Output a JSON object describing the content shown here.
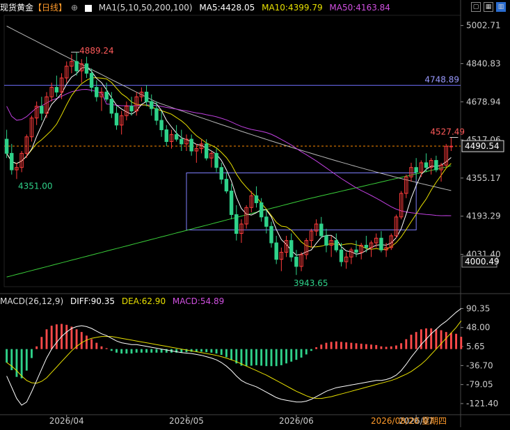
{
  "header": {
    "instrument": "现货黄金",
    "period": "【日线】",
    "ma_label": "MA1(5,10,50,200,100)",
    "ma5": "MA5:4428.05",
    "ma10": "MA10:4399.79",
    "ma50": "MA50:4163.84"
  },
  "macd_header": {
    "label": "MACD(26,12,9)",
    "diff": "DIFF:90.35",
    "dea": "DEA:62.90",
    "macd": "MACD:54.89"
  },
  "colors": {
    "up": "#ff3b3b",
    "down": "#2fd28a",
    "ma5": "#ffffff",
    "ma10": "#e8e000",
    "ma50": "#c040e0",
    "ma100": "#b8b8b8",
    "ma200": "#3ad03a",
    "hline": "#7070ff",
    "box": "#8080ff",
    "last": "#ff8a00"
  },
  "chart_data": {
    "type": "candlestick",
    "x_tick_labels": [
      "2026/04",
      "2026/05",
      "2026/06",
      "2026/07",
      "2026/08/20 星期四"
    ],
    "price_axis": {
      "range": [
        3900,
        5040
      ],
      "ticks": [
        5002.71,
        4840.83,
        4678.94,
        4517.06,
        4355.17,
        4193.29,
        4031.4
      ]
    },
    "last_price": 4490.54,
    "box_bottom_price": 4000.49,
    "horizontal_line": 4748.89,
    "labels": {
      "high": "4889.24",
      "low_april": "4351.00",
      "low_july": "3943.65",
      "recent_high": "4527.49",
      "hline": "4748.89",
      "last": "4490.54",
      "box_bottom": "4000.49"
    },
    "candles": [
      [
        4520,
        4560,
        4440,
        4460
      ],
      [
        4460,
        4500,
        4370,
        4390
      ],
      [
        4390,
        4420,
        4351,
        4400
      ],
      [
        4400,
        4470,
        4380,
        4460
      ],
      [
        4460,
        4540,
        4440,
        4530
      ],
      [
        4530,
        4620,
        4510,
        4610
      ],
      [
        4610,
        4680,
        4580,
        4660
      ],
      [
        4660,
        4700,
        4600,
        4630
      ],
      [
        4630,
        4720,
        4610,
        4700
      ],
      [
        4700,
        4760,
        4680,
        4740
      ],
      [
        4740,
        4790,
        4700,
        4720
      ],
      [
        4720,
        4800,
        4690,
        4780
      ],
      [
        4780,
        4850,
        4760,
        4830
      ],
      [
        4830,
        4880,
        4800,
        4850
      ],
      [
        4850,
        4889.24,
        4790,
        4810
      ],
      [
        4810,
        4860,
        4760,
        4840
      ],
      [
        4840,
        4870,
        4780,
        4800
      ],
      [
        4800,
        4820,
        4720,
        4740
      ],
      [
        4740,
        4770,
        4680,
        4700
      ],
      [
        4700,
        4740,
        4640,
        4720
      ],
      [
        4720,
        4760,
        4680,
        4690
      ],
      [
        4690,
        4720,
        4610,
        4630
      ],
      [
        4630,
        4660,
        4560,
        4580
      ],
      [
        4580,
        4640,
        4540,
        4620
      ],
      [
        4620,
        4680,
        4600,
        4660
      ],
      [
        4660,
        4700,
        4620,
        4640
      ],
      [
        4640,
        4720,
        4620,
        4700
      ],
      [
        4700,
        4740,
        4680,
        4720
      ],
      [
        4720,
        4750,
        4660,
        4680
      ],
      [
        4680,
        4710,
        4620,
        4650
      ],
      [
        4650,
        4680,
        4580,
        4600
      ],
      [
        4600,
        4640,
        4530,
        4560
      ],
      [
        4560,
        4580,
        4490,
        4510
      ],
      [
        4510,
        4560,
        4480,
        4540
      ],
      [
        4540,
        4580,
        4510,
        4520
      ],
      [
        4520,
        4560,
        4470,
        4500
      ],
      [
        4500,
        4540,
        4470,
        4520
      ],
      [
        4520,
        4540,
        4450,
        4470
      ],
      [
        4470,
        4500,
        4420,
        4480
      ],
      [
        4480,
        4520,
        4460,
        4500
      ],
      [
        4500,
        4520,
        4430,
        4440
      ],
      [
        4440,
        4470,
        4400,
        4460
      ],
      [
        4460,
        4480,
        4380,
        4400
      ],
      [
        4400,
        4420,
        4330,
        4350
      ],
      [
        4350,
        4380,
        4290,
        4300
      ],
      [
        4300,
        4330,
        4180,
        4200
      ],
      [
        4200,
        4240,
        4090,
        4120
      ],
      [
        4120,
        4180,
        4080,
        4160
      ],
      [
        4160,
        4240,
        4140,
        4230
      ],
      [
        4230,
        4300,
        4210,
        4280
      ],
      [
        4280,
        4320,
        4230,
        4250
      ],
      [
        4250,
        4270,
        4170,
        4190
      ],
      [
        4190,
        4220,
        4120,
        4150
      ],
      [
        4150,
        4170,
        4060,
        4080
      ],
      [
        4080,
        4110,
        3990,
        4010
      ],
      [
        4010,
        4060,
        3960,
        4040
      ],
      [
        4040,
        4110,
        4020,
        4090
      ],
      [
        4090,
        4120,
        4000,
        4020
      ],
      [
        4020,
        4050,
        3943.65,
        3980
      ],
      [
        3980,
        4040,
        3960,
        4030
      ],
      [
        4030,
        4100,
        4010,
        4090
      ],
      [
        4090,
        4140,
        4060,
        4130
      ],
      [
        4130,
        4180,
        4110,
        4160
      ],
      [
        4160,
        4190,
        4100,
        4110
      ],
      [
        4110,
        4140,
        4040,
        4070
      ],
      [
        4070,
        4110,
        4020,
        4090
      ],
      [
        4090,
        4120,
        4040,
        4050
      ],
      [
        4050,
        4080,
        3980,
        4000
      ],
      [
        4000,
        4040,
        3970,
        4020
      ],
      [
        4020,
        4060,
        3990,
        4050
      ],
      [
        4050,
        4090,
        4020,
        4040
      ],
      [
        4040,
        4080,
        4010,
        4070
      ],
      [
        4070,
        4110,
        4040,
        4060
      ],
      [
        4060,
        4090,
        4020,
        4080
      ],
      [
        4080,
        4120,
        4060,
        4100
      ],
      [
        4100,
        4130,
        4040,
        4050
      ],
      [
        4050,
        4080,
        4020,
        4060
      ],
      [
        4060,
        4120,
        4050,
        4110
      ],
      [
        4110,
        4200,
        4100,
        4190
      ],
      [
        4190,
        4300,
        4180,
        4290
      ],
      [
        4290,
        4370,
        4270,
        4360
      ],
      [
        4360,
        4420,
        4340,
        4400
      ],
      [
        4400,
        4440,
        4350,
        4380
      ],
      [
        4380,
        4430,
        4360,
        4420
      ],
      [
        4420,
        4460,
        4380,
        4400
      ],
      [
        4400,
        4440,
        4370,
        4430
      ],
      [
        4430,
        4450,
        4380,
        4390
      ],
      [
        4390,
        4420,
        4340,
        4410
      ],
      [
        4410,
        4500,
        4400,
        4490
      ],
      [
        4490,
        4527.49,
        4470,
        4490.54
      ]
    ],
    "macd_axis": {
      "range": [
        -140,
        108
      ],
      "ticks": [
        90.35,
        48.0,
        5.65,
        -36.7,
        -79.05,
        -121.4
      ]
    },
    "diff": [
      -60,
      -85,
      -110,
      -125,
      -118,
      -95,
      -70,
      -45,
      -20,
      0,
      15,
      28,
      38,
      46,
      50,
      52,
      50,
      46,
      40,
      34,
      30,
      24,
      18,
      14,
      12,
      10,
      10,
      8,
      6,
      4,
      2,
      0,
      -2,
      -4,
      -6,
      -8,
      -9,
      -10,
      -12,
      -14,
      -17,
      -20,
      -24,
      -30,
      -38,
      -48,
      -60,
      -70,
      -76,
      -80,
      -84,
      -90,
      -96,
      -102,
      -108,
      -112,
      -114,
      -116,
      -118,
      -118,
      -116,
      -112,
      -106,
      -100,
      -94,
      -90,
      -86,
      -84,
      -82,
      -80,
      -78,
      -76,
      -74,
      -72,
      -70,
      -70,
      -68,
      -64,
      -58,
      -48,
      -34,
      -18,
      -4,
      10,
      22,
      34,
      44,
      54,
      62,
      72,
      82,
      90.35
    ],
    "dea": [
      -30,
      -38,
      -48,
      -60,
      -70,
      -75,
      -76,
      -72,
      -64,
      -52,
      -40,
      -28,
      -16,
      -4,
      6,
      14,
      20,
      24,
      26,
      28,
      28,
      28,
      26,
      24,
      22,
      20,
      18,
      16,
      14,
      12,
      10,
      8,
      6,
      4,
      2,
      0,
      -2,
      -4,
      -6,
      -8,
      -10,
      -12,
      -14,
      -17,
      -20,
      -24,
      -28,
      -33,
      -38,
      -43,
      -48,
      -53,
      -58,
      -64,
      -70,
      -76,
      -82,
      -88,
      -94,
      -99,
      -104,
      -108,
      -110,
      -110,
      -108,
      -106,
      -103,
      -100,
      -97,
      -94,
      -91,
      -88,
      -85,
      -82,
      -79,
      -76,
      -73,
      -70,
      -66,
      -61,
      -56,
      -50,
      -42,
      -34,
      -24,
      -12,
      0,
      12,
      24,
      36,
      48,
      62.9
    ]
  }
}
